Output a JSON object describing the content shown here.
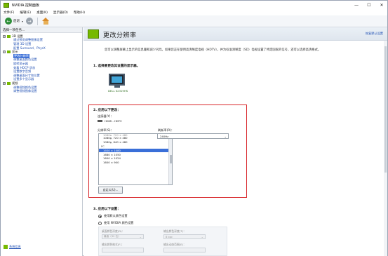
{
  "window": {
    "title": "NVIDIA 控制面板",
    "minimize_glyph": "—",
    "maximize_glyph": "☐",
    "close_glyph": "✕"
  },
  "menu": [
    "文件(F)",
    "编辑(E)",
    "桌面(K)",
    "显示器(D)",
    "帮助(H)"
  ],
  "toolbar": {
    "back_label": "后退",
    "back_glyph": "←",
    "forward_glyph": "→",
    "caret": "▾"
  },
  "left_panel": {
    "header": "选择一项任务...",
    "tree": [
      {
        "kind": "cat",
        "expander": "⊟",
        "label": "3D 设置"
      },
      {
        "kind": "item",
        "label": "通过预览调整图像设置"
      },
      {
        "kind": "item",
        "label": "管理 3D 设置"
      },
      {
        "kind": "item",
        "label": "配置 Surround、PhysX"
      },
      {
        "kind": "cat",
        "expander": "⊟",
        "label": "显示"
      },
      {
        "kind": "item",
        "label": "更改分辨率",
        "selected": true
      },
      {
        "kind": "item",
        "label": "调整桌面颜色设置"
      },
      {
        "kind": "item",
        "label": "旋转显示器"
      },
      {
        "kind": "item",
        "label": "查看 HDCP 状态"
      },
      {
        "kind": "item",
        "label": "设置数字音频"
      },
      {
        "kind": "item",
        "label": "调整桌面尺寸和位置"
      },
      {
        "kind": "item",
        "label": "设置多个显示器"
      },
      {
        "kind": "cat",
        "expander": "⊟",
        "label": "视频"
      },
      {
        "kind": "item",
        "label": "调整视频颜色设置"
      },
      {
        "kind": "item",
        "label": "调整视频图像设置"
      }
    ],
    "footer_link": "系统信息"
  },
  "main": {
    "page_title": "更改分辨率",
    "restore_link": "恢复默认设置",
    "description": "您可以调整屏幕上显示的信息量和减少闪烁。如果您正在使用高清晰度电视（HDTV），并为标准清晰度（SD）电视设置了特定国家的信号，还可以选择高清格式。",
    "section1_title": "1. 选择要更改其设置的显示器。",
    "monitor_label": "DELL S2319HS",
    "section2_title": "2. 应用以下更改：",
    "connector_label": "连接器(Y)：",
    "connector_value": "HDMI - HDTV",
    "resolution_label": "分辨率(S)：",
    "resolution_items": [
      {
        "text": "1080p, 720 × 480",
        "kind": "cut"
      },
      {
        "text": "1080p, 720 × 480",
        "kind": "item"
      },
      {
        "text": "1080p, 640 × 480",
        "kind": "item"
      },
      {
        "text": "PC",
        "kind": "group"
      },
      {
        "text": "1920 × 1080",
        "kind": "item",
        "selected": true
      },
      {
        "text": "1680 × 1050",
        "kind": "item"
      },
      {
        "text": "1600 × 1024",
        "kind": "item"
      },
      {
        "text": "1600 × 900",
        "kind": "item"
      }
    ],
    "refresh_label": "刷新率(R)：",
    "refresh_value": "240Hz",
    "custom_button": "自定义(U)...",
    "section3_title": "3. 应用以下设置：",
    "radio_default": "使用默认颜色设置",
    "radio_nvidia": "使用 NVIDIA 颜色设置",
    "desktop_depth_label": "桌面颜色深度(D)：",
    "desktop_depth_value": "最高（32 位）",
    "output_depth_label": "输出颜色深度(T)：",
    "output_depth_value": "8 bpc",
    "output_format_label": "输出颜色格式(F)：",
    "output_range_label": "输出动态范围(E)："
  },
  "colors": {
    "nvidia_green": "#76b900",
    "selection_blue": "#3a6fd8",
    "highlight_red": "#d8262b",
    "link_blue": "#1f4fb3"
  }
}
